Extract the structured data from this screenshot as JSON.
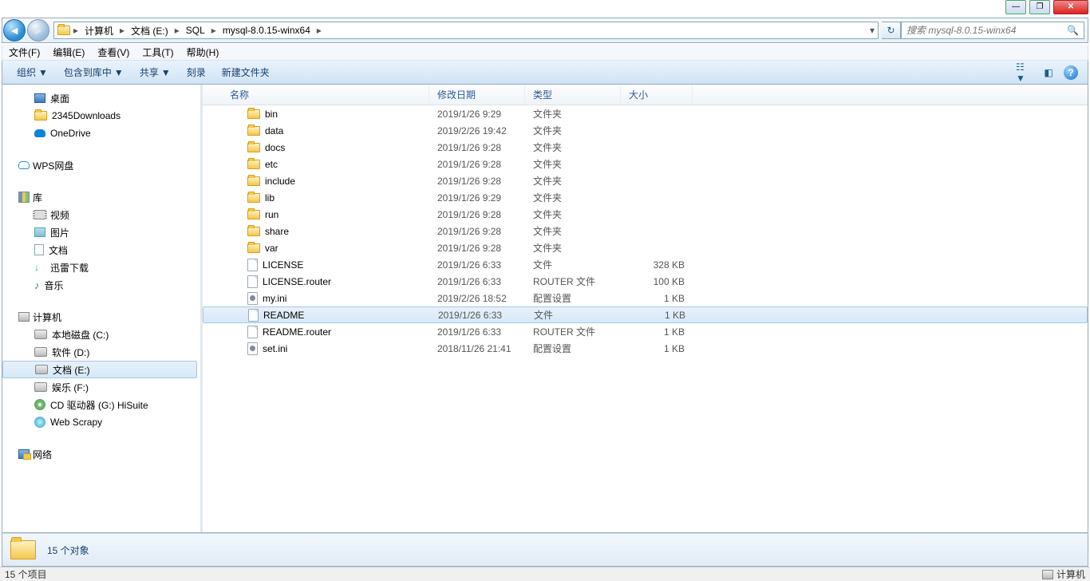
{
  "window_controls": {
    "min": "—",
    "max": "❐",
    "close": "✕"
  },
  "breadcrumb": [
    "计算机",
    "文档 (E:)",
    "SQL",
    "mysql-8.0.15-winx64"
  ],
  "search_placeholder": "搜索 mysql-8.0.15-winx64",
  "menubar": [
    "文件(F)",
    "编辑(E)",
    "查看(V)",
    "工具(T)",
    "帮助(H)"
  ],
  "toolbar": {
    "organize": "组织",
    "include": "包含到库中",
    "share": "共享",
    "burn": "刻录",
    "newfolder": "新建文件夹"
  },
  "sidebar": {
    "favorites": [
      {
        "icon": "desktop",
        "label": "桌面"
      },
      {
        "icon": "folder",
        "label": "2345Downloads"
      },
      {
        "icon": "onedrive",
        "label": "OneDrive"
      }
    ],
    "wps": {
      "label": "WPS网盘",
      "icon": "cloud"
    },
    "libraries": {
      "label": "库",
      "items": [
        {
          "icon": "video",
          "label": "视频"
        },
        {
          "icon": "pic",
          "label": "图片"
        },
        {
          "icon": "doc",
          "label": "文档"
        },
        {
          "icon": "dl",
          "label": "迅雷下载"
        },
        {
          "icon": "music",
          "label": "音乐"
        }
      ]
    },
    "computer": {
      "label": "计算机",
      "items": [
        {
          "icon": "drive",
          "label": "本地磁盘 (C:)"
        },
        {
          "icon": "drive",
          "label": "软件 (D:)"
        },
        {
          "icon": "drive",
          "label": "文档 (E:)",
          "selected": true
        },
        {
          "icon": "drive",
          "label": "娱乐 (F:)"
        },
        {
          "icon": "disc",
          "label": "CD 驱动器 (G:) HiSuite"
        },
        {
          "icon": "web",
          "label": "Web   Scrapy"
        }
      ]
    },
    "network": {
      "label": "网络",
      "icon": "net"
    }
  },
  "columns": {
    "name": "名称",
    "date": "修改日期",
    "type": "类型",
    "size": "大小"
  },
  "files": [
    {
      "icon": "folder",
      "name": "bin",
      "date": "2019/1/26 9:29",
      "type": "文件夹",
      "size": ""
    },
    {
      "icon": "folder",
      "name": "data",
      "date": "2019/2/26 19:42",
      "type": "文件夹",
      "size": ""
    },
    {
      "icon": "folder",
      "name": "docs",
      "date": "2019/1/26 9:28",
      "type": "文件夹",
      "size": ""
    },
    {
      "icon": "folder",
      "name": "etc",
      "date": "2019/1/26 9:28",
      "type": "文件夹",
      "size": ""
    },
    {
      "icon": "folder",
      "name": "include",
      "date": "2019/1/26 9:28",
      "type": "文件夹",
      "size": ""
    },
    {
      "icon": "folder",
      "name": "lib",
      "date": "2019/1/26 9:29",
      "type": "文件夹",
      "size": ""
    },
    {
      "icon": "folder",
      "name": "run",
      "date": "2019/1/26 9:28",
      "type": "文件夹",
      "size": ""
    },
    {
      "icon": "folder",
      "name": "share",
      "date": "2019/1/26 9:28",
      "type": "文件夹",
      "size": ""
    },
    {
      "icon": "folder",
      "name": "var",
      "date": "2019/1/26 9:28",
      "type": "文件夹",
      "size": ""
    },
    {
      "icon": "file",
      "name": "LICENSE",
      "date": "2019/1/26 6:33",
      "type": "文件",
      "size": "328 KB"
    },
    {
      "icon": "file",
      "name": "LICENSE.router",
      "date": "2019/1/26 6:33",
      "type": "ROUTER 文件",
      "size": "100 KB"
    },
    {
      "icon": "ini",
      "name": "my.ini",
      "date": "2019/2/26 18:52",
      "type": "配置设置",
      "size": "1 KB"
    },
    {
      "icon": "file",
      "name": "README",
      "date": "2019/1/26 6:33",
      "type": "文件",
      "size": "1 KB",
      "selected": true
    },
    {
      "icon": "file",
      "name": "README.router",
      "date": "2019/1/26 6:33",
      "type": "ROUTER 文件",
      "size": "1 KB"
    },
    {
      "icon": "ini",
      "name": "set.ini",
      "date": "2018/11/26 21:41",
      "type": "配置设置",
      "size": "1 KB"
    }
  ],
  "details": "15 个对象",
  "status": {
    "left": "15 个项目",
    "right": "计算机"
  }
}
